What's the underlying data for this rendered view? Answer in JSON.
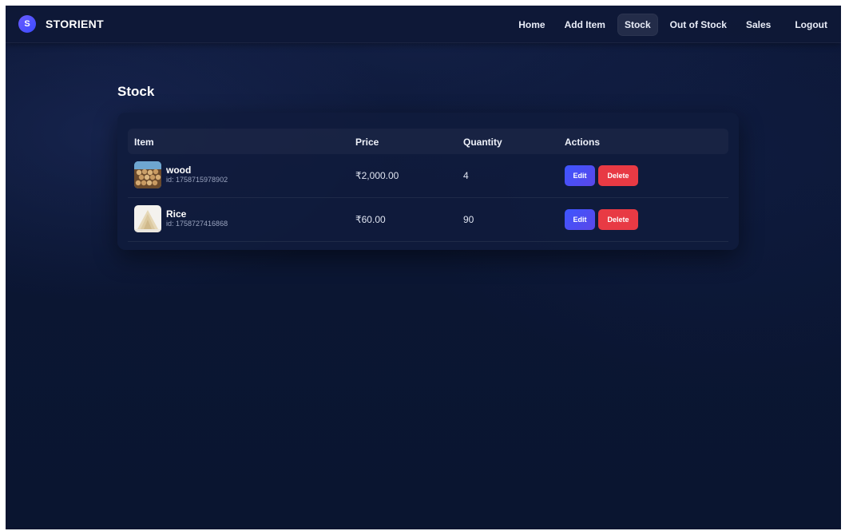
{
  "brand": {
    "logo_letter": "S",
    "name": "STORIENT"
  },
  "nav": {
    "items": [
      {
        "label": "Home",
        "active": false
      },
      {
        "label": "Add Item",
        "active": false
      },
      {
        "label": "Stock",
        "active": true
      },
      {
        "label": "Out of Stock",
        "active": false
      },
      {
        "label": "Sales",
        "active": false
      },
      {
        "label": "Logout",
        "active": false
      }
    ]
  },
  "page": {
    "title": "Stock"
  },
  "table": {
    "headers": {
      "item": "Item",
      "price": "Price",
      "quantity": "Quantity",
      "actions": "Actions"
    },
    "rows": [
      {
        "name": "wood",
        "id": "id: 1758715978902",
        "price": "₹2,000.00",
        "quantity": "4",
        "thumbnail": "wood-logs-image",
        "edit_label": "Edit",
        "delete_label": "Delete"
      },
      {
        "name": "Rice",
        "id": "id: 1758727416868",
        "price": "₹60.00",
        "quantity": "90",
        "thumbnail": "rice-pile-image",
        "edit_label": "Edit",
        "delete_label": "Delete"
      }
    ]
  },
  "colors": {
    "background": "#0b1633",
    "accent": "#3d55ff",
    "danger": "#e83a44"
  }
}
